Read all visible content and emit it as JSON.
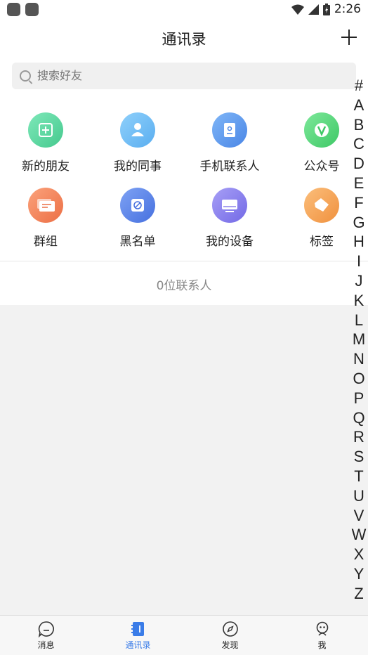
{
  "status_bar": {
    "time": "2:26"
  },
  "header": {
    "title": "通讯录"
  },
  "search": {
    "placeholder": "搜索好友"
  },
  "grid": [
    {
      "label": "新的朋友",
      "icon": "plus-square-icon",
      "color": "#5dd6a3"
    },
    {
      "label": "我的同事",
      "icon": "person-icon",
      "color": "#6fbcf5"
    },
    {
      "label": "手机联系人",
      "icon": "contact-card-icon",
      "color": "#5d9bf0"
    },
    {
      "label": "公众号",
      "icon": "v-badge-icon",
      "color": "#4fd16f"
    },
    {
      "label": "群组",
      "icon": "chat-bubbles-icon",
      "color": "#f38a5f"
    },
    {
      "label": "黑名单",
      "icon": "block-icon",
      "color": "#5b82e8"
    },
    {
      "label": "我的设备",
      "icon": "monitor-icon",
      "color": "#8b82ee"
    },
    {
      "label": "标签",
      "icon": "tag-icon",
      "color": "#f6a85a"
    }
  ],
  "contact_count": "0位联系人",
  "alphabet": [
    "#",
    "A",
    "B",
    "C",
    "D",
    "E",
    "F",
    "G",
    "H",
    "I",
    "J",
    "K",
    "L",
    "M",
    "N",
    "O",
    "P",
    "Q",
    "R",
    "S",
    "T",
    "U",
    "V",
    "W",
    "X",
    "Y",
    "Z"
  ],
  "tabs": [
    {
      "label": "消息",
      "icon": "message-icon",
      "active": false
    },
    {
      "label": "通讯录",
      "icon": "contacts-book-icon",
      "active": true
    },
    {
      "label": "发现",
      "icon": "compass-icon",
      "active": false
    },
    {
      "label": "我",
      "icon": "profile-icon",
      "active": false
    }
  ],
  "colors": {
    "accent": "#3a7ce8"
  }
}
